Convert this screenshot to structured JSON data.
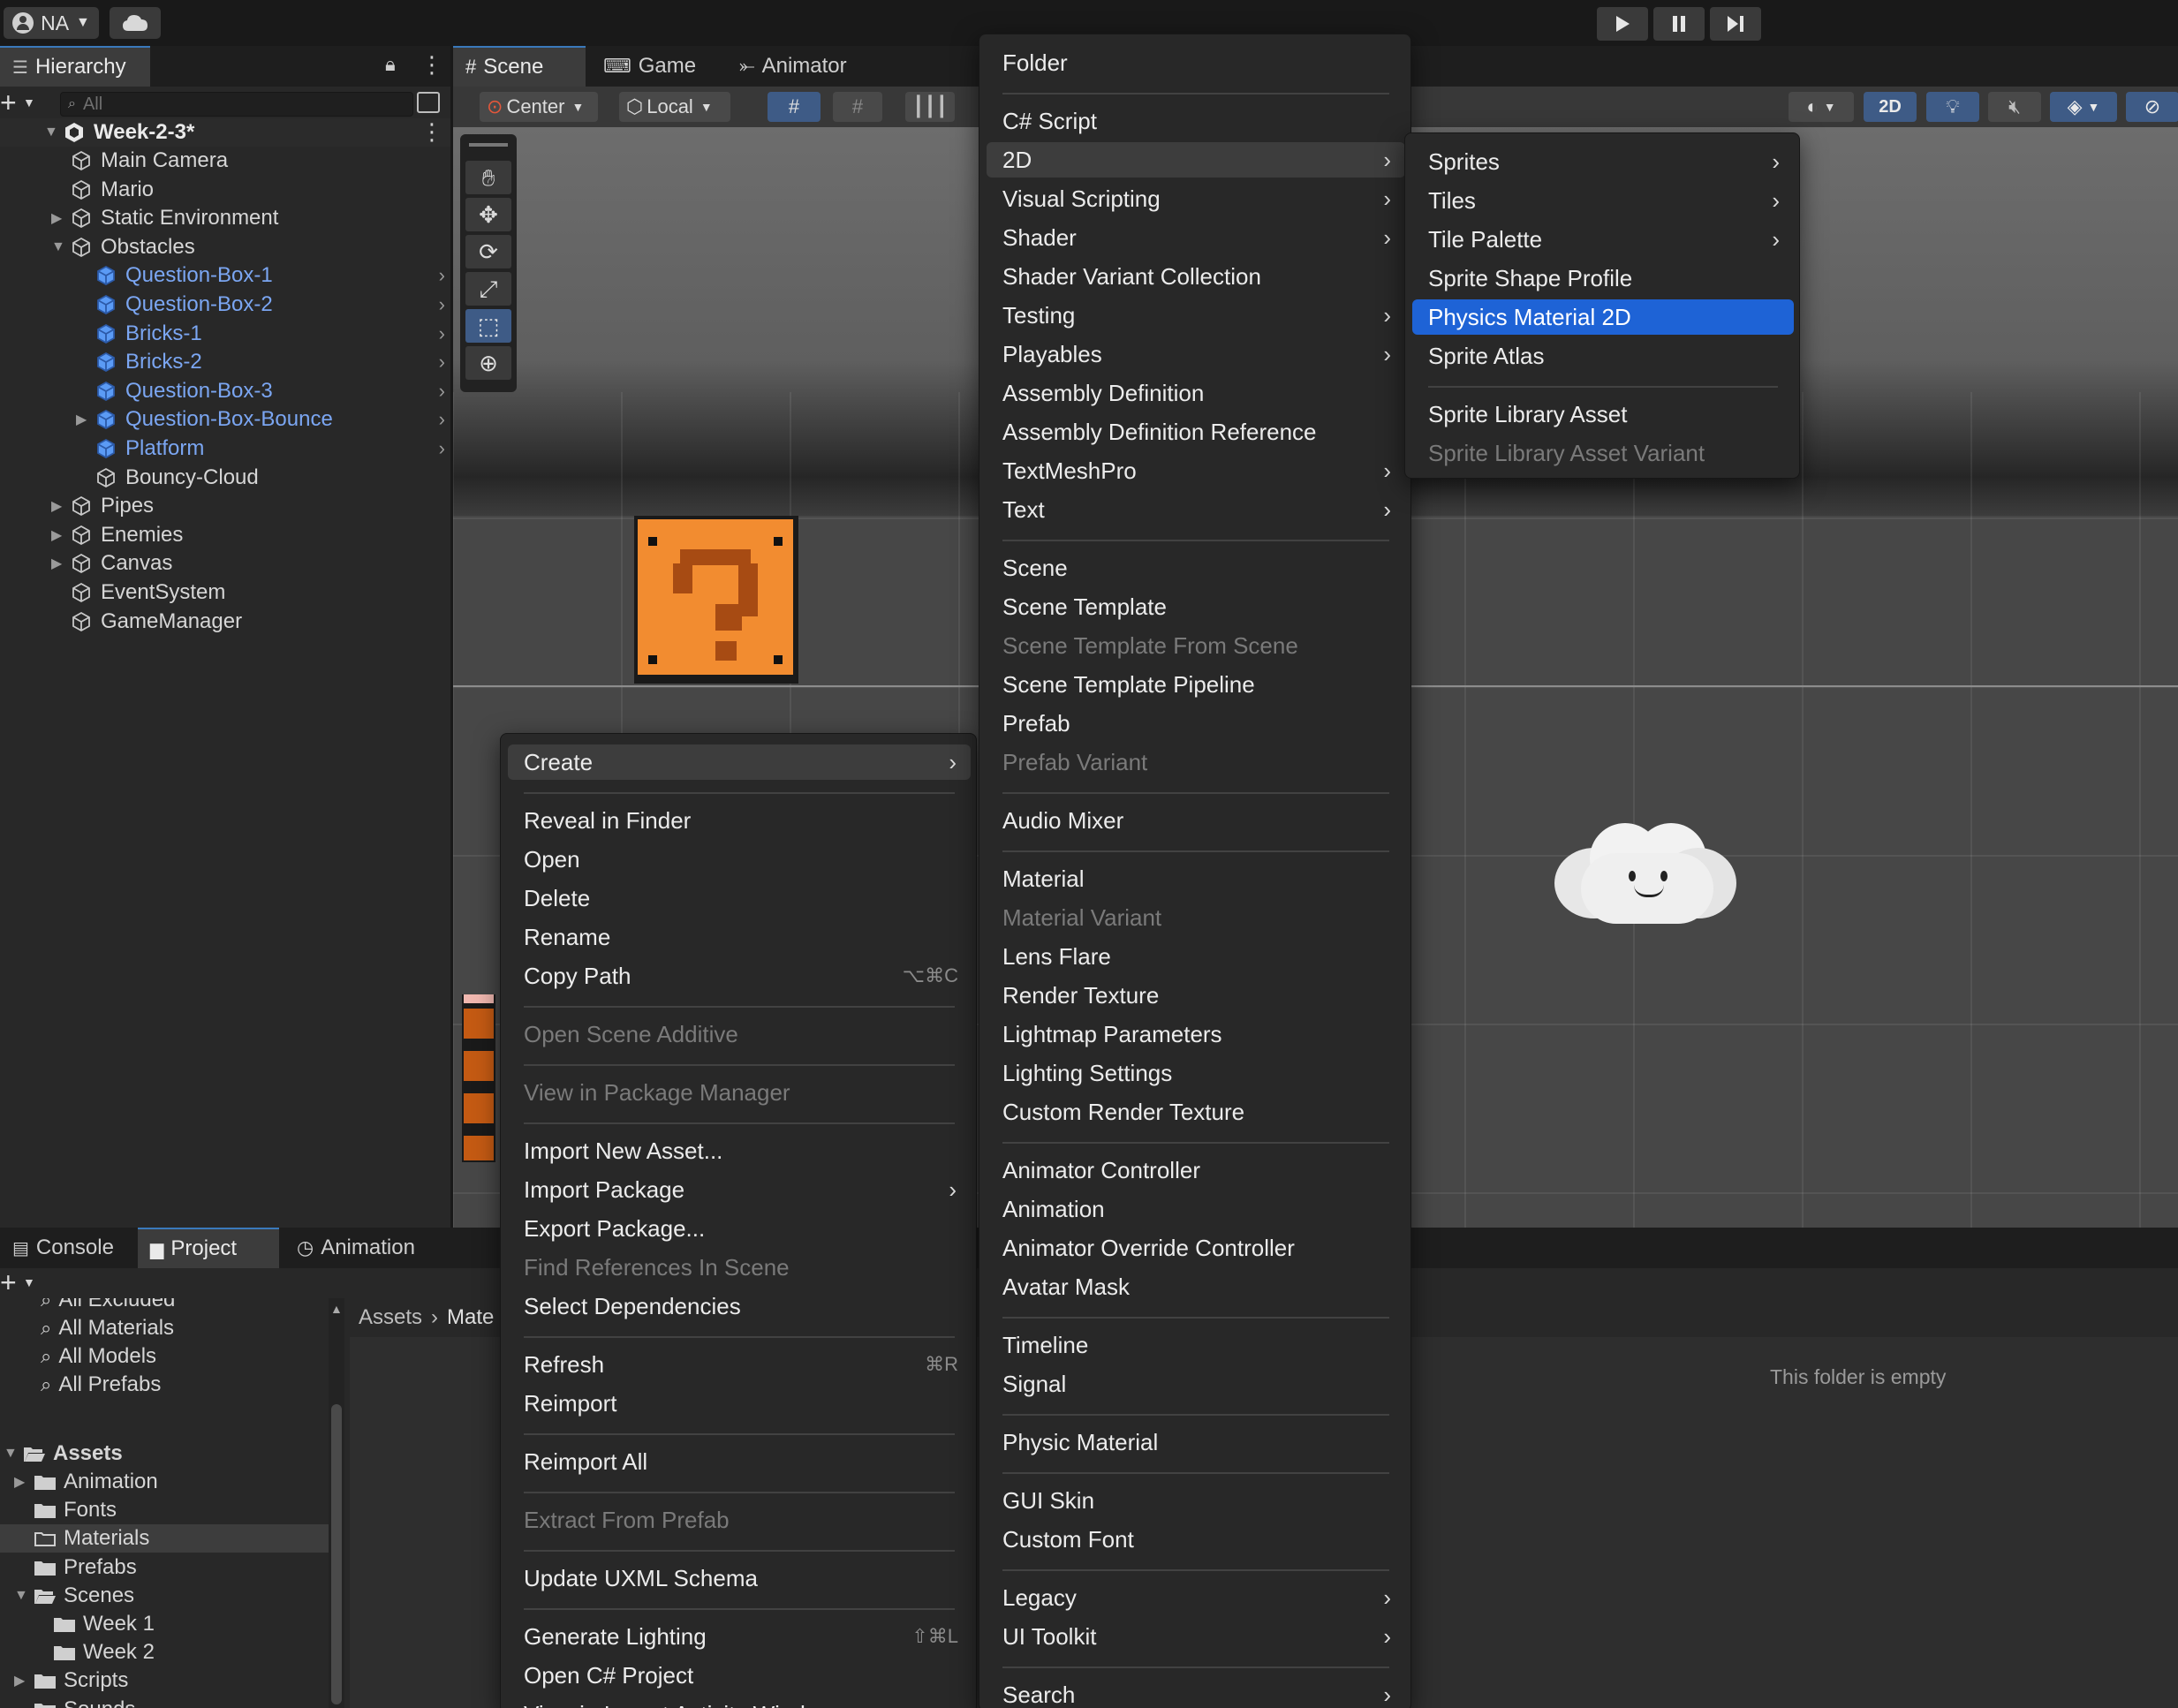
{
  "toolbar": {
    "account_label": "NA",
    "icons": [
      "account-icon",
      "cloud-icon",
      "play-icon",
      "pause-icon",
      "step-icon"
    ]
  },
  "hierarchy": {
    "tab_label": "Hierarchy",
    "search_placeholder": "All",
    "scene_name": "Week-2-3*",
    "items": [
      {
        "label": "Main Camera",
        "indent": 1,
        "prefab": false,
        "fold": ""
      },
      {
        "label": "Mario",
        "indent": 1,
        "prefab": false,
        "fold": ""
      },
      {
        "label": "Static Environment",
        "indent": 1,
        "prefab": false,
        "fold": "right"
      },
      {
        "label": "Obstacles",
        "indent": 1,
        "prefab": false,
        "fold": "down"
      },
      {
        "label": "Question-Box-1",
        "indent": 2,
        "prefab": true,
        "fold": ""
      },
      {
        "label": "Question-Box-2",
        "indent": 2,
        "prefab": true,
        "fold": ""
      },
      {
        "label": "Bricks-1",
        "indent": 2,
        "prefab": true,
        "fold": ""
      },
      {
        "label": "Bricks-2",
        "indent": 2,
        "prefab": true,
        "fold": ""
      },
      {
        "label": "Question-Box-3",
        "indent": 2,
        "prefab": true,
        "fold": ""
      },
      {
        "label": "Question-Box-Bounce",
        "indent": 2,
        "prefab": true,
        "fold": "right"
      },
      {
        "label": "Platform",
        "indent": 2,
        "prefab": true,
        "fold": ""
      },
      {
        "label": "Bouncy-Cloud",
        "indent": 2,
        "prefab": false,
        "fold": ""
      },
      {
        "label": "Pipes",
        "indent": 1,
        "prefab": false,
        "fold": "right"
      },
      {
        "label": "Enemies",
        "indent": 1,
        "prefab": false,
        "fold": "right"
      },
      {
        "label": "Canvas",
        "indent": 1,
        "prefab": false,
        "fold": "right"
      },
      {
        "label": "EventSystem",
        "indent": 1,
        "prefab": false,
        "fold": ""
      },
      {
        "label": "GameManager",
        "indent": 1,
        "prefab": false,
        "fold": ""
      }
    ]
  },
  "scene_tabs": {
    "scene": "Scene",
    "game": "Game",
    "animator": "Animator",
    "pivot": "Center",
    "space": "Local",
    "mode_2d": "2D"
  },
  "bottom_tabs": {
    "console": "Console",
    "project": "Project",
    "animation": "Animation"
  },
  "project": {
    "favorites": [
      "All Excluded",
      "All Materials",
      "All Models",
      "All Prefabs"
    ],
    "assets_label": "Assets",
    "folders": [
      {
        "label": "Animation",
        "indent": 1,
        "fold": "right"
      },
      {
        "label": "Fonts",
        "indent": 1,
        "fold": ""
      },
      {
        "label": "Materials",
        "indent": 1,
        "fold": ""
      },
      {
        "label": "Prefabs",
        "indent": 1,
        "fold": ""
      },
      {
        "label": "Scenes",
        "indent": 1,
        "fold": "down"
      },
      {
        "label": "Week 1",
        "indent": 2,
        "fold": ""
      },
      {
        "label": "Week 2",
        "indent": 2,
        "fold": ""
      },
      {
        "label": "Scripts",
        "indent": 1,
        "fold": "right"
      },
      {
        "label": "Sounds",
        "indent": 1,
        "fold": ""
      }
    ],
    "breadcrumb_root": "Assets",
    "breadcrumb_current": "Mate",
    "empty_text": "This folder is empty"
  },
  "context_menu": {
    "items": [
      {
        "label": "Create",
        "type": "sub",
        "state": "sel"
      },
      {
        "label": "Reveal in Finder"
      },
      {
        "label": "Open"
      },
      {
        "label": "Delete"
      },
      {
        "label": "Rename"
      },
      {
        "label": "Copy Path",
        "shortcut": "⌥⌘C"
      },
      {
        "label": "Open Scene Additive",
        "state": "dis"
      },
      {
        "label": "View in Package Manager",
        "state": "dis"
      },
      {
        "label": "Import New Asset..."
      },
      {
        "label": "Import Package",
        "type": "sub"
      },
      {
        "label": "Export Package..."
      },
      {
        "label": "Find References In Scene",
        "state": "dis"
      },
      {
        "label": "Select Dependencies"
      },
      {
        "label": "Refresh",
        "shortcut": "⌘R"
      },
      {
        "label": "Reimport"
      },
      {
        "label": "Reimport All"
      },
      {
        "label": "Extract From Prefab",
        "state": "dis"
      },
      {
        "label": "Update UXML Schema"
      },
      {
        "label": "Generate Lighting",
        "shortcut": "⇧⌘L"
      },
      {
        "label": "Open C# Project"
      },
      {
        "label": "View in Import Activity Window"
      }
    ]
  },
  "create_menu": {
    "items": [
      {
        "label": "Folder"
      },
      {
        "label": "C# Script"
      },
      {
        "label": "2D",
        "type": "sub",
        "state": "sel"
      },
      {
        "label": "Visual Scripting",
        "type": "sub"
      },
      {
        "label": "Shader",
        "type": "sub"
      },
      {
        "label": "Shader Variant Collection"
      },
      {
        "label": "Testing",
        "type": "sub"
      },
      {
        "label": "Playables",
        "type": "sub"
      },
      {
        "label": "Assembly Definition"
      },
      {
        "label": "Assembly Definition Reference"
      },
      {
        "label": "TextMeshPro",
        "type": "sub"
      },
      {
        "label": "Text",
        "type": "sub"
      },
      {
        "label": "Scene"
      },
      {
        "label": "Scene Template"
      },
      {
        "label": "Scene Template From Scene",
        "state": "dis"
      },
      {
        "label": "Scene Template Pipeline"
      },
      {
        "label": "Prefab"
      },
      {
        "label": "Prefab Variant",
        "state": "dis"
      },
      {
        "label": "Audio Mixer"
      },
      {
        "label": "Material"
      },
      {
        "label": "Material Variant",
        "state": "dis"
      },
      {
        "label": "Lens Flare"
      },
      {
        "label": "Render Texture"
      },
      {
        "label": "Lightmap Parameters"
      },
      {
        "label": "Lighting Settings"
      },
      {
        "label": "Custom Render Texture"
      },
      {
        "label": "Animator Controller"
      },
      {
        "label": "Animation"
      },
      {
        "label": "Animator Override Controller"
      },
      {
        "label": "Avatar Mask"
      },
      {
        "label": "Timeline"
      },
      {
        "label": "Signal"
      },
      {
        "label": "Physic Material"
      },
      {
        "label": "GUI Skin"
      },
      {
        "label": "Custom Font"
      },
      {
        "label": "Legacy",
        "type": "sub"
      },
      {
        "label": "UI Toolkit",
        "type": "sub"
      },
      {
        "label": "Search",
        "type": "sub"
      }
    ]
  },
  "submenu_2d": {
    "items": [
      {
        "label": "Sprites",
        "type": "sub"
      },
      {
        "label": "Tiles",
        "type": "sub"
      },
      {
        "label": "Tile Palette",
        "type": "sub"
      },
      {
        "label": "Sprite Shape Profile"
      },
      {
        "label": "Physics Material 2D",
        "state": "hi"
      },
      {
        "label": "Sprite Atlas"
      },
      {
        "label": "Sprite Library Asset"
      },
      {
        "label": "Sprite Library Asset Variant",
        "state": "dis"
      }
    ]
  },
  "colors": {
    "highlight": "#1e63d6",
    "prefab_text": "#7ba6f2",
    "accent_tab": "#3a79bb",
    "menu_bg": "#282828"
  }
}
